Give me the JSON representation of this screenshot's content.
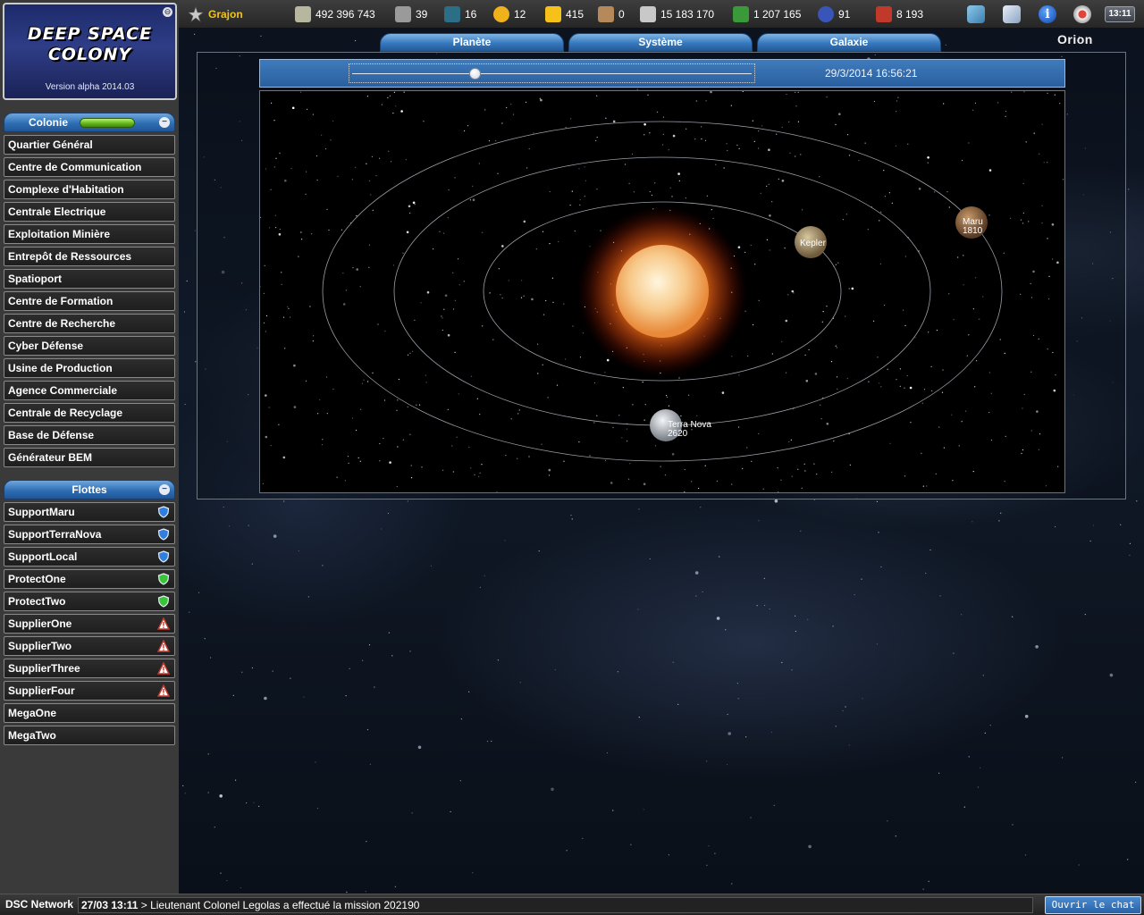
{
  "header": {
    "logo_title_line1": "DEEP SPACE",
    "logo_title_line2": "COLONY",
    "version": "Version alpha 2014.03",
    "close_glyph": "⊖"
  },
  "player": {
    "name": "Grajon"
  },
  "resources": [
    {
      "icon": "credits-icon",
      "value": "492 396 743"
    },
    {
      "icon": "population-icon",
      "value": "39"
    },
    {
      "icon": "agent-icon",
      "value": "16"
    },
    {
      "icon": "food-icon",
      "value": "12"
    },
    {
      "icon": "energy-icon",
      "value": "415"
    },
    {
      "icon": "crate-icon",
      "value": "0"
    },
    {
      "icon": "ore-icon",
      "value": "15 183 170"
    },
    {
      "icon": "crystal-icon",
      "value": "1 207 165"
    },
    {
      "icon": "sphere-icon",
      "value": "91"
    },
    {
      "icon": "points-icon",
      "value": "8 193"
    }
  ],
  "toolbar": {
    "clock": "13:11"
  },
  "tabs": [
    {
      "label": "Planète"
    },
    {
      "label": "Système"
    },
    {
      "label": "Galaxie"
    }
  ],
  "galaxy_name": "Orion",
  "timeline": {
    "timestamp": "29/3/2014 16:56:21",
    "position": 0.31
  },
  "colonie": {
    "title": "Colonie",
    "collapse_glyph": "−",
    "items": [
      "Quartier Général",
      "Centre de Communication",
      "Complexe d'Habitation",
      "Centrale Electrique",
      "Exploitation Minière",
      "Entrepôt de Ressources",
      "Spatioport",
      "Centre de Formation",
      "Centre de Recherche",
      "Cyber Défense",
      "Usine de Production",
      "Agence Commerciale",
      "Centrale de Recyclage",
      "Base de Défense",
      "Générateur BEM"
    ]
  },
  "flottes": {
    "title": "Flottes",
    "collapse_glyph": "−",
    "items": [
      {
        "label": "SupportMaru",
        "status": "blue-shield-icon"
      },
      {
        "label": "SupportTerraNova",
        "status": "blue-shield-icon"
      },
      {
        "label": "SupportLocal",
        "status": "blue-shield-icon"
      },
      {
        "label": "ProtectOne",
        "status": "green-shield-icon"
      },
      {
        "label": "ProtectTwo",
        "status": "green-shield-icon"
      },
      {
        "label": "SupplierOne",
        "status": "warning-icon"
      },
      {
        "label": "SupplierTwo",
        "status": "warning-icon"
      },
      {
        "label": "SupplierThree",
        "status": "warning-icon"
      },
      {
        "label": "SupplierFour",
        "status": "warning-icon"
      },
      {
        "label": "MegaOne",
        "status": ""
      },
      {
        "label": "MegaTwo",
        "status": ""
      }
    ]
  },
  "planets": [
    {
      "name": "Kepler",
      "number": ""
    },
    {
      "name": "Maru",
      "number": "1810"
    },
    {
      "name": "Terra Nova",
      "number": "2620"
    }
  ],
  "chat": {
    "network_label": "DSC Network",
    "time": "27/03 13:11",
    "message": " > Lieutenant Colonel Legolas a effectué la mission 202190",
    "open_button": "Ouvrir le chat"
  },
  "colors": {
    "accent_blue": "#2f6eb4",
    "player_name": "#f0c419",
    "sun": "#f7a13a"
  }
}
